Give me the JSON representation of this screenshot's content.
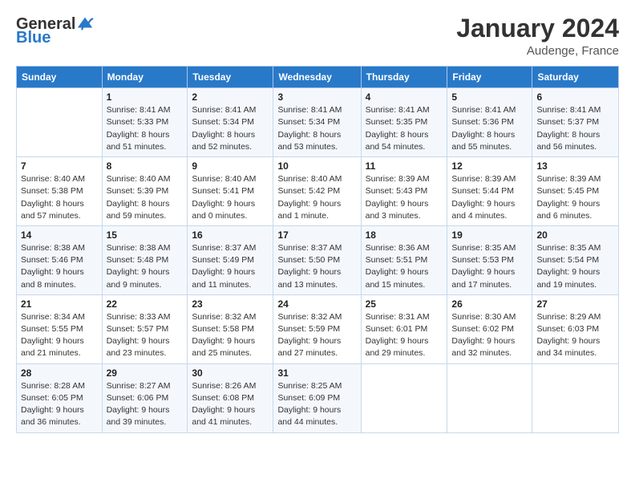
{
  "header": {
    "logo_general": "General",
    "logo_blue": "Blue",
    "month": "January 2024",
    "location": "Audenge, France"
  },
  "days_of_week": [
    "Sunday",
    "Monday",
    "Tuesday",
    "Wednesday",
    "Thursday",
    "Friday",
    "Saturday"
  ],
  "weeks": [
    [
      {
        "day": "",
        "sunrise": "",
        "sunset": "",
        "daylight": ""
      },
      {
        "day": "1",
        "sunrise": "Sunrise: 8:41 AM",
        "sunset": "Sunset: 5:33 PM",
        "daylight": "Daylight: 8 hours and 51 minutes."
      },
      {
        "day": "2",
        "sunrise": "Sunrise: 8:41 AM",
        "sunset": "Sunset: 5:34 PM",
        "daylight": "Daylight: 8 hours and 52 minutes."
      },
      {
        "day": "3",
        "sunrise": "Sunrise: 8:41 AM",
        "sunset": "Sunset: 5:34 PM",
        "daylight": "Daylight: 8 hours and 53 minutes."
      },
      {
        "day": "4",
        "sunrise": "Sunrise: 8:41 AM",
        "sunset": "Sunset: 5:35 PM",
        "daylight": "Daylight: 8 hours and 54 minutes."
      },
      {
        "day": "5",
        "sunrise": "Sunrise: 8:41 AM",
        "sunset": "Sunset: 5:36 PM",
        "daylight": "Daylight: 8 hours and 55 minutes."
      },
      {
        "day": "6",
        "sunrise": "Sunrise: 8:41 AM",
        "sunset": "Sunset: 5:37 PM",
        "daylight": "Daylight: 8 hours and 56 minutes."
      }
    ],
    [
      {
        "day": "7",
        "sunrise": "Sunrise: 8:40 AM",
        "sunset": "Sunset: 5:38 PM",
        "daylight": "Daylight: 8 hours and 57 minutes."
      },
      {
        "day": "8",
        "sunrise": "Sunrise: 8:40 AM",
        "sunset": "Sunset: 5:39 PM",
        "daylight": "Daylight: 8 hours and 59 minutes."
      },
      {
        "day": "9",
        "sunrise": "Sunrise: 8:40 AM",
        "sunset": "Sunset: 5:41 PM",
        "daylight": "Daylight: 9 hours and 0 minutes."
      },
      {
        "day": "10",
        "sunrise": "Sunrise: 8:40 AM",
        "sunset": "Sunset: 5:42 PM",
        "daylight": "Daylight: 9 hours and 1 minute."
      },
      {
        "day": "11",
        "sunrise": "Sunrise: 8:39 AM",
        "sunset": "Sunset: 5:43 PM",
        "daylight": "Daylight: 9 hours and 3 minutes."
      },
      {
        "day": "12",
        "sunrise": "Sunrise: 8:39 AM",
        "sunset": "Sunset: 5:44 PM",
        "daylight": "Daylight: 9 hours and 4 minutes."
      },
      {
        "day": "13",
        "sunrise": "Sunrise: 8:39 AM",
        "sunset": "Sunset: 5:45 PM",
        "daylight": "Daylight: 9 hours and 6 minutes."
      }
    ],
    [
      {
        "day": "14",
        "sunrise": "Sunrise: 8:38 AM",
        "sunset": "Sunset: 5:46 PM",
        "daylight": "Daylight: 9 hours and 8 minutes."
      },
      {
        "day": "15",
        "sunrise": "Sunrise: 8:38 AM",
        "sunset": "Sunset: 5:48 PM",
        "daylight": "Daylight: 9 hours and 9 minutes."
      },
      {
        "day": "16",
        "sunrise": "Sunrise: 8:37 AM",
        "sunset": "Sunset: 5:49 PM",
        "daylight": "Daylight: 9 hours and 11 minutes."
      },
      {
        "day": "17",
        "sunrise": "Sunrise: 8:37 AM",
        "sunset": "Sunset: 5:50 PM",
        "daylight": "Daylight: 9 hours and 13 minutes."
      },
      {
        "day": "18",
        "sunrise": "Sunrise: 8:36 AM",
        "sunset": "Sunset: 5:51 PM",
        "daylight": "Daylight: 9 hours and 15 minutes."
      },
      {
        "day": "19",
        "sunrise": "Sunrise: 8:35 AM",
        "sunset": "Sunset: 5:53 PM",
        "daylight": "Daylight: 9 hours and 17 minutes."
      },
      {
        "day": "20",
        "sunrise": "Sunrise: 8:35 AM",
        "sunset": "Sunset: 5:54 PM",
        "daylight": "Daylight: 9 hours and 19 minutes."
      }
    ],
    [
      {
        "day": "21",
        "sunrise": "Sunrise: 8:34 AM",
        "sunset": "Sunset: 5:55 PM",
        "daylight": "Daylight: 9 hours and 21 minutes."
      },
      {
        "day": "22",
        "sunrise": "Sunrise: 8:33 AM",
        "sunset": "Sunset: 5:57 PM",
        "daylight": "Daylight: 9 hours and 23 minutes."
      },
      {
        "day": "23",
        "sunrise": "Sunrise: 8:32 AM",
        "sunset": "Sunset: 5:58 PM",
        "daylight": "Daylight: 9 hours and 25 minutes."
      },
      {
        "day": "24",
        "sunrise": "Sunrise: 8:32 AM",
        "sunset": "Sunset: 5:59 PM",
        "daylight": "Daylight: 9 hours and 27 minutes."
      },
      {
        "day": "25",
        "sunrise": "Sunrise: 8:31 AM",
        "sunset": "Sunset: 6:01 PM",
        "daylight": "Daylight: 9 hours and 29 minutes."
      },
      {
        "day": "26",
        "sunrise": "Sunrise: 8:30 AM",
        "sunset": "Sunset: 6:02 PM",
        "daylight": "Daylight: 9 hours and 32 minutes."
      },
      {
        "day": "27",
        "sunrise": "Sunrise: 8:29 AM",
        "sunset": "Sunset: 6:03 PM",
        "daylight": "Daylight: 9 hours and 34 minutes."
      }
    ],
    [
      {
        "day": "28",
        "sunrise": "Sunrise: 8:28 AM",
        "sunset": "Sunset: 6:05 PM",
        "daylight": "Daylight: 9 hours and 36 minutes."
      },
      {
        "day": "29",
        "sunrise": "Sunrise: 8:27 AM",
        "sunset": "Sunset: 6:06 PM",
        "daylight": "Daylight: 9 hours and 39 minutes."
      },
      {
        "day": "30",
        "sunrise": "Sunrise: 8:26 AM",
        "sunset": "Sunset: 6:08 PM",
        "daylight": "Daylight: 9 hours and 41 minutes."
      },
      {
        "day": "31",
        "sunrise": "Sunrise: 8:25 AM",
        "sunset": "Sunset: 6:09 PM",
        "daylight": "Daylight: 9 hours and 44 minutes."
      },
      {
        "day": "",
        "sunrise": "",
        "sunset": "",
        "daylight": ""
      },
      {
        "day": "",
        "sunrise": "",
        "sunset": "",
        "daylight": ""
      },
      {
        "day": "",
        "sunrise": "",
        "sunset": "",
        "daylight": ""
      }
    ]
  ]
}
